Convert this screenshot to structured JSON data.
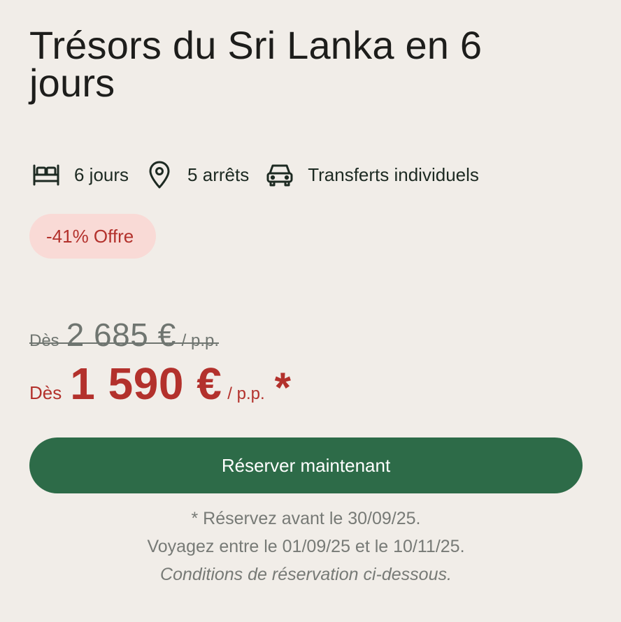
{
  "title": "Trésors du Sri Lanka en 6 jours",
  "features": [
    {
      "icon": "bed-icon",
      "label": "6 jours"
    },
    {
      "icon": "location-pin-icon",
      "label": "5 arrêts"
    },
    {
      "icon": "car-icon",
      "label": "Transferts individuels"
    }
  ],
  "badge": {
    "label": "-41% Offre",
    "bg_color": "#f9dad6",
    "text_color": "#b3312c"
  },
  "old_price": {
    "prefix": "Dès",
    "amount": "2 685 €",
    "unit": "/ p.p."
  },
  "new_price": {
    "prefix": "Dès",
    "amount": "1 590 €",
    "unit": "/ p.p.",
    "asterisk": "*",
    "color": "#b3312c"
  },
  "cta": {
    "label": "Réserver maintenant",
    "color": "#2d6b48"
  },
  "conditions": {
    "line1": "* Réservez avant le 30/09/25.",
    "line2": "Voyagez entre le 01/09/25 et le 10/11/25.",
    "line3": "Conditions de réservation ci-dessous."
  }
}
